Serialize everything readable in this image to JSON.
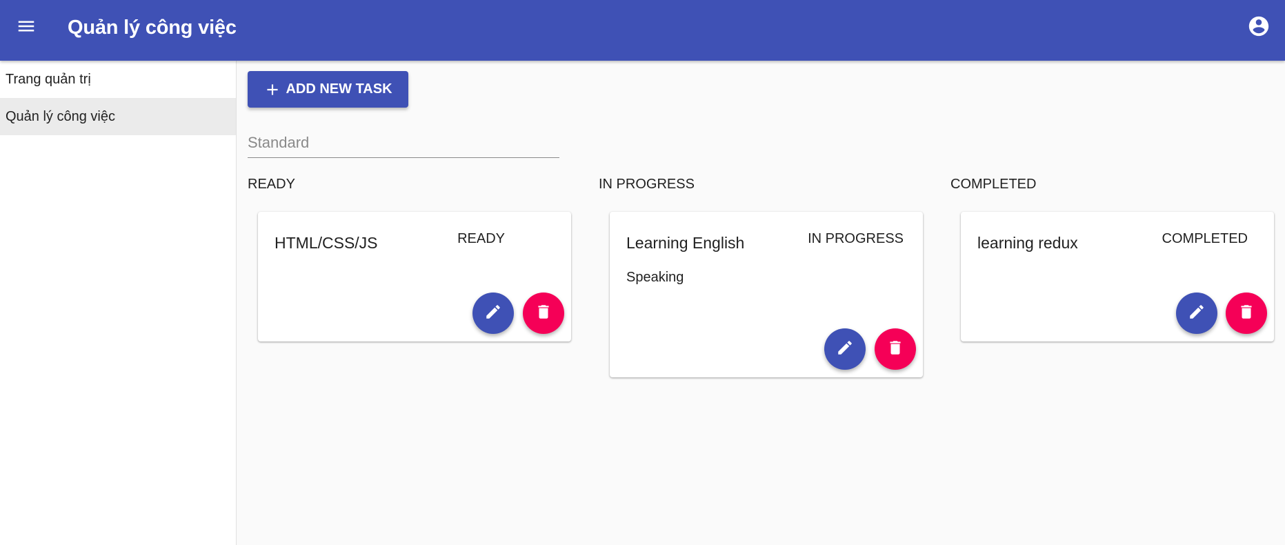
{
  "app": {
    "title": "Quản lý công việc",
    "primary_color": "#3f51b5",
    "secondary_color": "#f50057"
  },
  "header": {
    "menu_icon": "menu-icon",
    "account_icon": "account-circle-icon"
  },
  "sidebar": {
    "items": [
      {
        "label": "Trang quản trị",
        "active": false
      },
      {
        "label": "Quản lý công việc",
        "active": true
      }
    ]
  },
  "toolbar": {
    "add_label": "ADD NEW TASK",
    "add_icon": "plus-icon"
  },
  "filter": {
    "placeholder": "Standard",
    "value": ""
  },
  "columns": [
    {
      "label": "READY",
      "tasks": [
        {
          "title": "HTML/CSS/JS",
          "status": "READY",
          "description": ""
        }
      ]
    },
    {
      "label": "IN PROGRESS",
      "tasks": [
        {
          "title": "Learning English",
          "status": "IN PROGRESS",
          "description": "Speaking"
        }
      ]
    },
    {
      "label": "COMPLETED",
      "tasks": [
        {
          "title": "learning redux",
          "status": "COMPLETED",
          "description": ""
        }
      ]
    }
  ]
}
